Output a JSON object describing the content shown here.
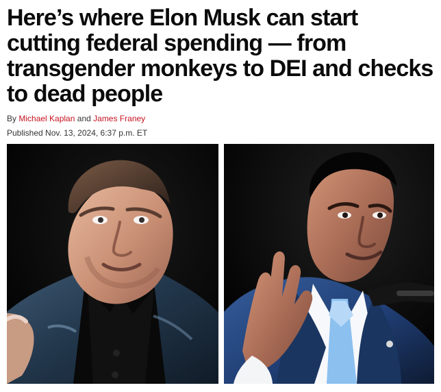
{
  "article": {
    "headline": "Here’s where Elon Musk can start cutting federal spending — from transgender monkeys to DEI and checks to dead people",
    "byline": {
      "prefix": "By",
      "author_1": "Michael Kaplan",
      "joiner": "and",
      "author_2": "James Franey"
    },
    "published": "Published Nov. 13, 2024, 6:37 p.m. ET",
    "link_color": "#c4121f"
  },
  "photos": [
    {
      "icon": "photo-person-leather-jacket"
    },
    {
      "icon": "photo-person-suit-raised-hand"
    }
  ]
}
